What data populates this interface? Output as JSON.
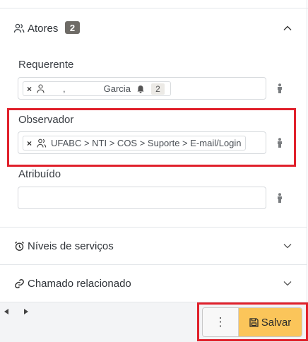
{
  "actors": {
    "title": "Atores",
    "count": "2",
    "requester": {
      "label": "Requerente",
      "tag_separator": ",",
      "tag_name": "Garcia",
      "tag_count": "2"
    },
    "observer": {
      "label": "Observador",
      "tag_text": "UFABC > NTI > COS > Suporte > E-mail/Login"
    },
    "assigned": {
      "label": "Atribuído"
    }
  },
  "sections": {
    "service_levels": "Níveis de serviços",
    "linked_ticket": "Chamado relacionado"
  },
  "footer": {
    "more_label": "⋮",
    "save_label": "Salvar"
  },
  "colors": {
    "highlight": "#e0202b",
    "save_button": "#fbc55a",
    "badge": "#6e6b66"
  }
}
